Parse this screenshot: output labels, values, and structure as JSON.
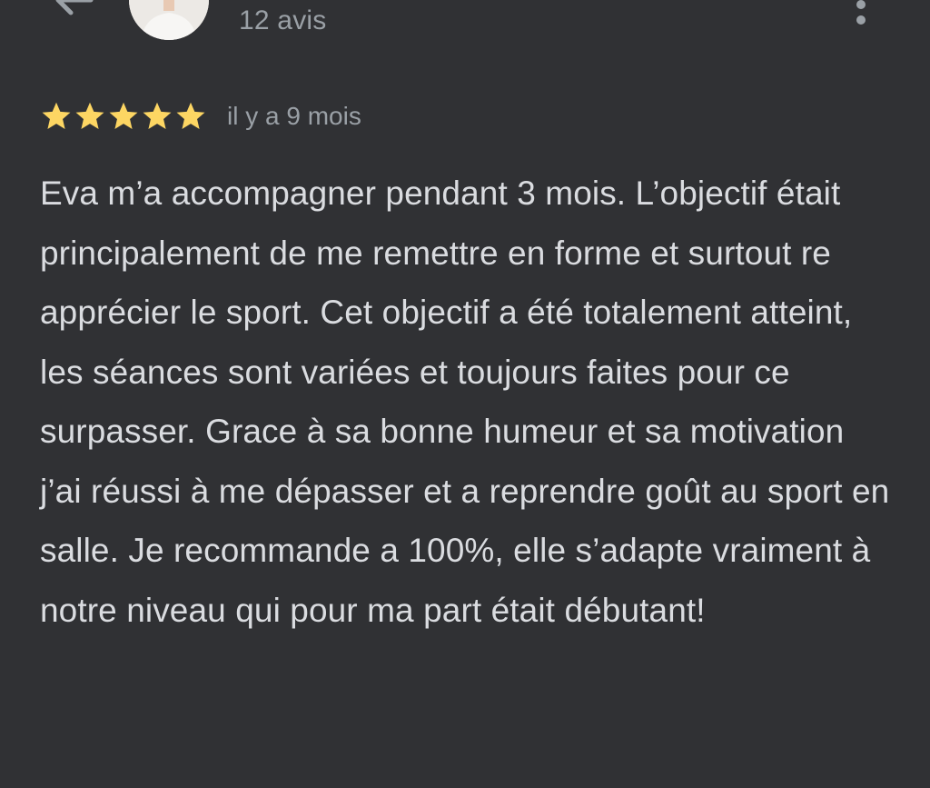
{
  "header": {
    "review_count": "12 avis",
    "back_icon": "arrow-left-icon",
    "more_icon": "more-vert-icon"
  },
  "review": {
    "rating": 5,
    "rating_max": 5,
    "star_color": "#fdd663",
    "date": "il y a 9 mois",
    "text": "Eva m’a accompagner pendant 3 mois. L’objectif était principalement de me remettre en forme et surtout re apprécier le sport. Cet objectif a été totalement atteint, les séances sont variées et toujours faites pour ce surpasser. Grace à sa bonne humeur et sa motivation j’ai réussi à me dépasser et a reprendre goût au sport en salle. Je recommande a 100%, elle s’adapte vraiment à notre niveau qui pour ma part était débutant!"
  },
  "colors": {
    "background": "#303134",
    "primary_text": "#dadce0",
    "secondary_text": "#9aa0a6"
  }
}
